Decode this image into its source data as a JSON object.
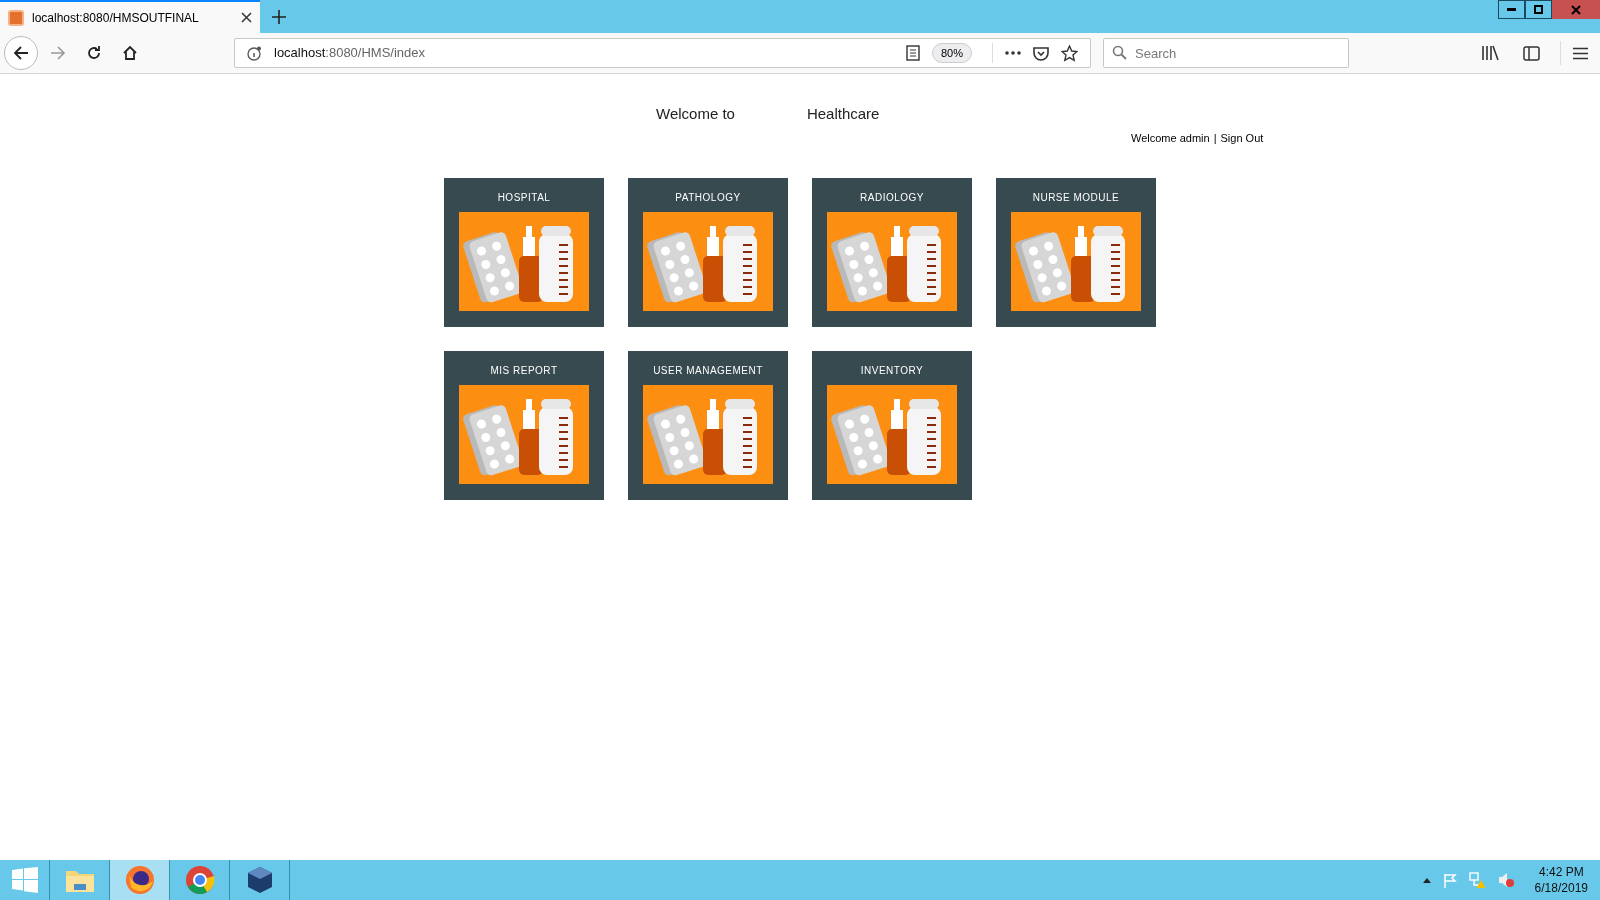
{
  "browser": {
    "tabs": [
      {
        "title": "localhost:8080/HMSOUTFINAL",
        "selected": true
      }
    ],
    "address": {
      "host": "localhost",
      "path": ":8080/HMS/index"
    },
    "zoom": "80%",
    "search": {
      "placeholder": "Search"
    }
  },
  "page": {
    "heading": [
      "Welcome to",
      "Healthcare"
    ],
    "user": {
      "greeting": "Welcome admin",
      "separator": "|",
      "sign_out": "Sign Out"
    },
    "tiles": [
      {
        "label": "HOSPITAL"
      },
      {
        "label": "PATHOLOGY"
      },
      {
        "label": "RADIOLOGY"
      },
      {
        "label": "NURSE MODULE"
      },
      {
        "label": "MIS REPORT"
      },
      {
        "label": "USER MANAGEMENT"
      },
      {
        "label": "INVENTORY"
      }
    ]
  },
  "taskbar": {
    "apps": [
      {
        "kind": "explorer",
        "selected": false
      },
      {
        "kind": "firefox",
        "selected": true
      },
      {
        "kind": "chrome",
        "selected": false
      },
      {
        "kind": "virtualbox",
        "selected": false
      }
    ],
    "time": "4:42 PM",
    "date": "6/18/2019"
  }
}
